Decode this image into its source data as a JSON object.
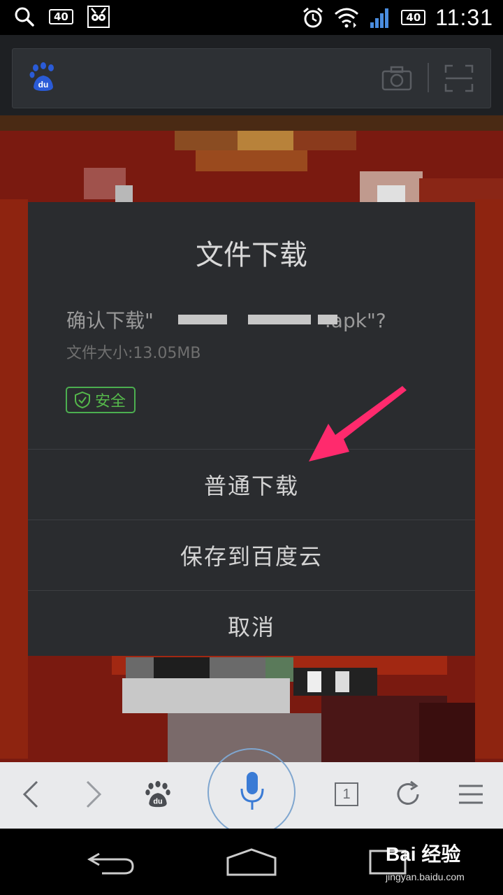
{
  "status_bar": {
    "notification_badge": "40",
    "signal_badge": "40",
    "time": "11:31"
  },
  "browser": {
    "logo_icon": "baidu-paw-icon",
    "camera_icon": "camera-icon",
    "scan_icon": "scan-icon"
  },
  "dialog": {
    "title": "文件下载",
    "confirm_prefix": "确认下载\"",
    "confirm_suffix": ".apk\"?",
    "file_size": "文件大小:13.05MB",
    "safe_label": "安全",
    "buttons": {
      "normal_download": "普通下载",
      "save_to_cloud": "保存到百度云",
      "cancel": "取消"
    }
  },
  "toolbar": {
    "tab_count": "1"
  },
  "watermark": {
    "brand": "Bai 经验",
    "url": "jingyan.baidu.com"
  },
  "colors": {
    "dialog_bg": "#2a2c2f",
    "safe_green": "#4caf50",
    "arrow_pink": "#ff2a6d",
    "page_red": "#7a1a10"
  }
}
